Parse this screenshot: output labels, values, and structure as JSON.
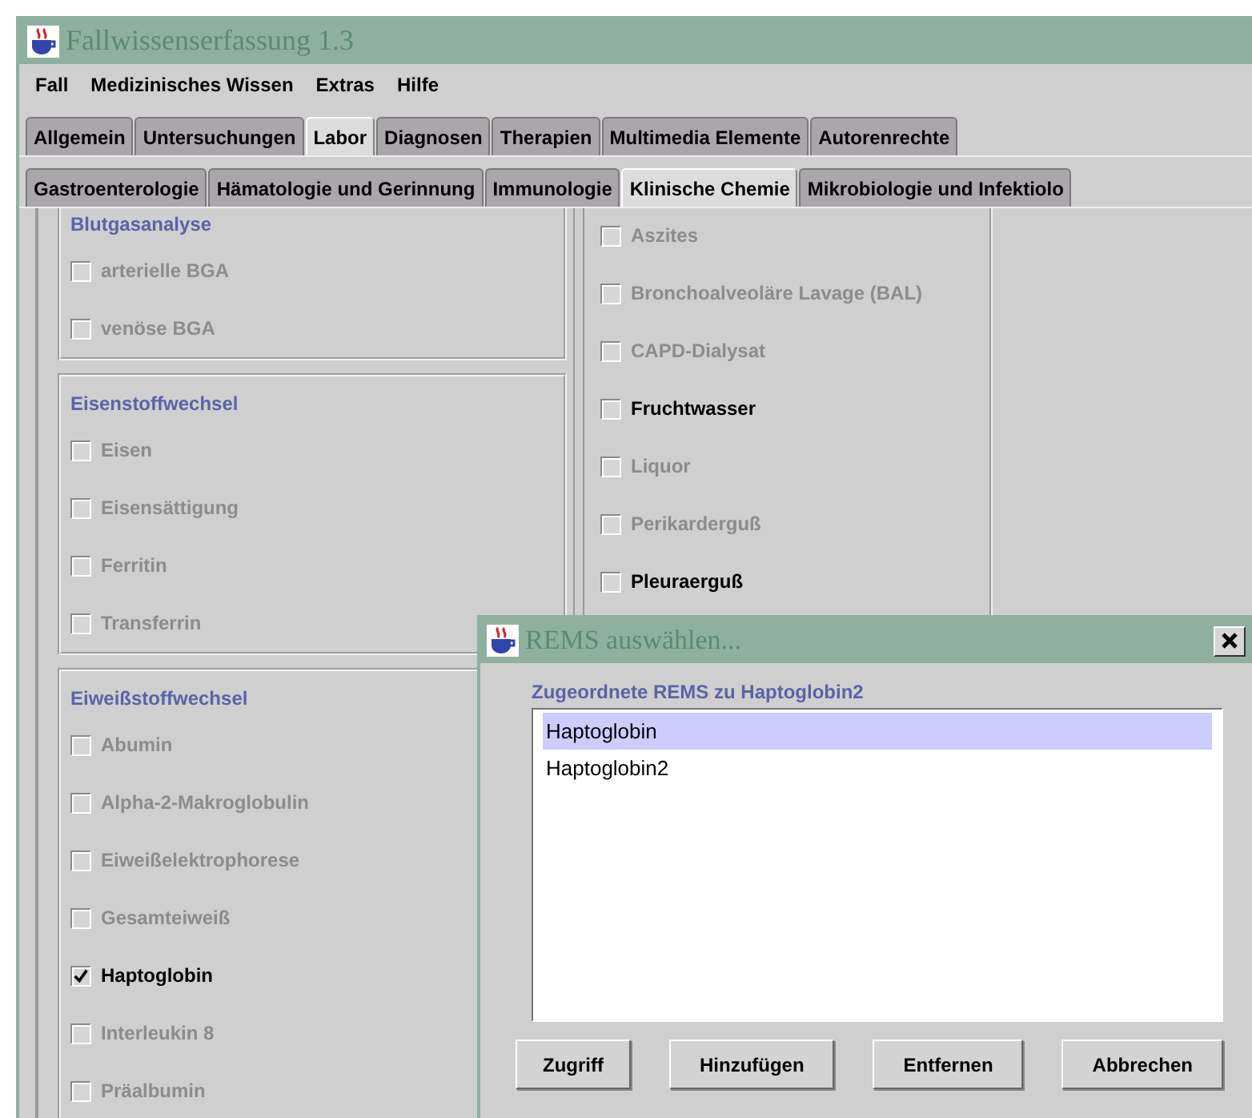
{
  "window": {
    "title": "Fallwissenserfassung 1.3"
  },
  "menu": [
    "Fall",
    "Medizinisches Wissen",
    "Extras",
    "Hilfe"
  ],
  "tabs": [
    {
      "label": "Allgemein",
      "selected": false
    },
    {
      "label": "Untersuchungen",
      "selected": false
    },
    {
      "label": "Labor",
      "selected": true
    },
    {
      "label": "Diagnosen",
      "selected": false
    },
    {
      "label": "Therapien",
      "selected": false
    },
    {
      "label": "Multimedia Elemente",
      "selected": false
    },
    {
      "label": "Autorenrechte",
      "selected": false
    }
  ],
  "subtabs": [
    {
      "label": "Gastroenterologie",
      "selected": false
    },
    {
      "label": "Hämatologie und Gerinnung",
      "selected": false
    },
    {
      "label": "Immunologie",
      "selected": false
    },
    {
      "label": "Klinische Chemie",
      "selected": true
    },
    {
      "label": "Mikrobiologie und Infektiolo",
      "selected": false
    }
  ],
  "left_groups": [
    {
      "title": "Blutgasanalyse",
      "items": [
        {
          "label": "arterielle BGA",
          "disabled": true,
          "checked": false
        },
        {
          "label": "venöse BGA",
          "disabled": true,
          "checked": false
        }
      ]
    },
    {
      "title": "Eisenstoffwechsel",
      "items": [
        {
          "label": "Eisen",
          "disabled": true,
          "checked": false
        },
        {
          "label": "Eisensättigung",
          "disabled": true,
          "checked": false
        },
        {
          "label": "Ferritin",
          "disabled": true,
          "checked": false
        },
        {
          "label": "Transferrin",
          "disabled": true,
          "checked": false
        }
      ]
    },
    {
      "title": "Eiweißstoffwechsel",
      "items": [
        {
          "label": "Abumin",
          "disabled": true,
          "checked": false
        },
        {
          "label": "Alpha-2-Makroglobulin",
          "disabled": true,
          "checked": false
        },
        {
          "label": "Eiweißelektrophorese",
          "disabled": true,
          "checked": false
        },
        {
          "label": "Gesamteiweiß",
          "disabled": true,
          "checked": false
        },
        {
          "label": "Haptoglobin",
          "disabled": false,
          "checked": true
        },
        {
          "label": "Interleukin 8",
          "disabled": true,
          "checked": false
        },
        {
          "label": "Präalbumin",
          "disabled": true,
          "checked": false
        }
      ]
    }
  ],
  "middle_items": [
    {
      "label": "Aszites",
      "disabled": true,
      "checked": false
    },
    {
      "label": "Bronchoalveoläre Lavage (BAL)",
      "disabled": true,
      "checked": false
    },
    {
      "label": "CAPD-Dialysat",
      "disabled": true,
      "checked": false
    },
    {
      "label": "Fruchtwasser",
      "disabled": false,
      "checked": false
    },
    {
      "label": "Liquor",
      "disabled": true,
      "checked": false
    },
    {
      "label": "Perikarderguß",
      "disabled": true,
      "checked": false
    },
    {
      "label": "Pleuraerguß",
      "disabled": false,
      "checked": false
    }
  ],
  "dialog": {
    "title": "REMS auswählen...",
    "label": "Zugeordnete REMS zu Haptoglobin2",
    "list": [
      {
        "label": "Haptoglobin",
        "selected": true
      },
      {
        "label": "Haptoglobin2",
        "selected": false
      }
    ],
    "buttons": [
      "Zugriff",
      "Hinzufügen",
      "Entfernen",
      "Abbrechen"
    ]
  }
}
